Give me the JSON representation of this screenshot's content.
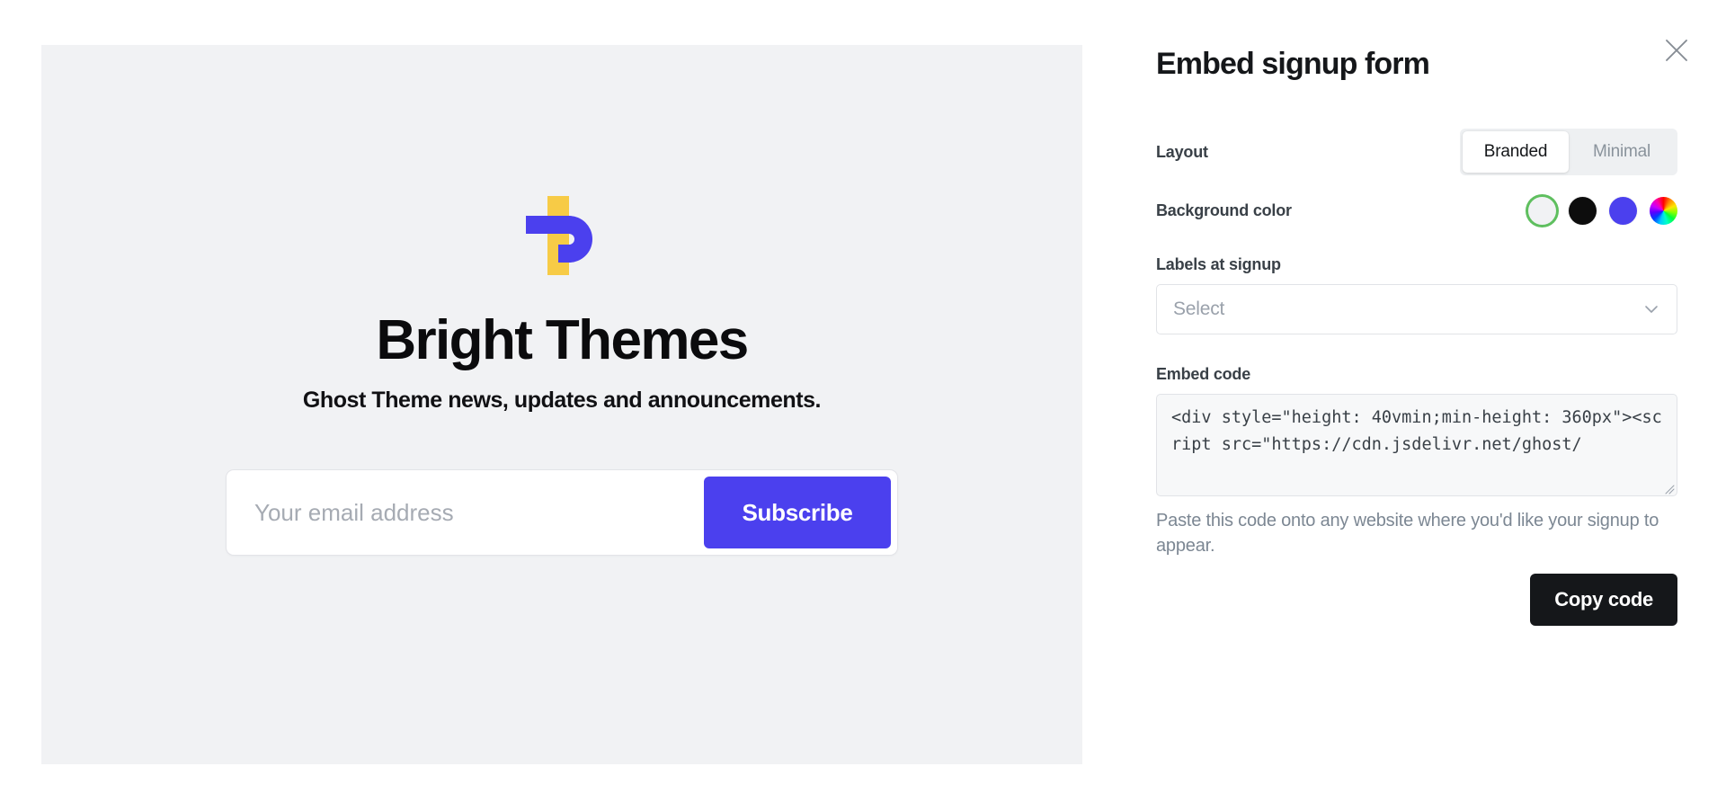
{
  "panel": {
    "title": "Embed signup form",
    "close_icon": "close-icon"
  },
  "preview": {
    "logo_icon": "bright-themes-logo-icon",
    "site_title": "Bright Themes",
    "site_description": "Ghost Theme news, updates and announcements.",
    "email_placeholder": "Your email address",
    "email_value": "",
    "subscribe_label": "Subscribe",
    "background_color": "#f1f2f4",
    "accent_color": "#4b40ee",
    "logo_yellow": "#f7cb46",
    "logo_blue": "#4b40ee"
  },
  "layout": {
    "label": "Layout",
    "options": [
      {
        "label": "Branded",
        "selected": true
      },
      {
        "label": "Minimal",
        "selected": false
      }
    ]
  },
  "background_color": {
    "label": "Background color",
    "swatches": [
      {
        "name": "white",
        "color": "#f1f2f4",
        "selected": true
      },
      {
        "name": "black",
        "color": "#0d0d0d",
        "selected": false
      },
      {
        "name": "accent",
        "color": "#4b40ee",
        "selected": false
      },
      {
        "name": "custom",
        "color": "rainbow",
        "selected": false
      }
    ],
    "selected_ring_color": "#5fbf5f"
  },
  "labels_at_signup": {
    "label": "Labels at signup",
    "placeholder": "Select",
    "value": "",
    "chevron_icon": "chevron-down-icon"
  },
  "embed_code": {
    "label": "Embed code",
    "value": "<div style=\"height: 40vmin;min-height: 360px\"><script src=\"https://cdn.jsdelivr.net/ghost/",
    "help": "Paste this code onto any website where you'd like your signup to appear."
  },
  "footer": {
    "copy_label": "Copy code"
  }
}
